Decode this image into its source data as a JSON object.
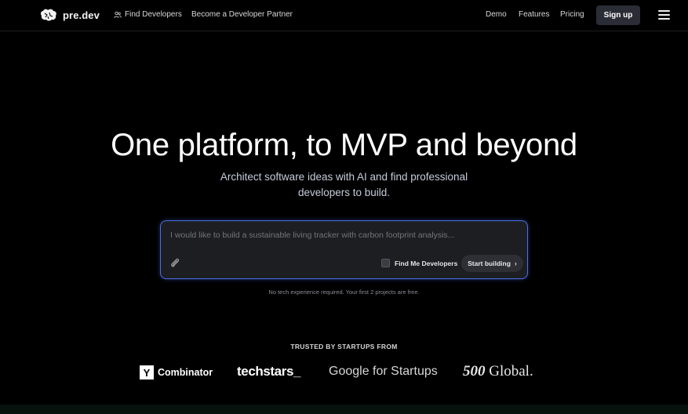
{
  "nav": {
    "brand": "pre.dev",
    "find_developers": "Find Developers",
    "become_partner": "Become a Developer Partner",
    "demo": "Demo",
    "features": "Features",
    "pricing": "Pricing",
    "signup": "Sign up"
  },
  "hero": {
    "title": "One platform, to MVP and beyond",
    "subtitle_line1": "Architect software ideas with AI and find professional",
    "subtitle_line2": "developers to build."
  },
  "prompt": {
    "placeholder": "I would like to build a sustainable living tracker with carbon footprint analysis...",
    "find_me_developers": "Find Me Developers",
    "find_me_developers_checked": false,
    "start_building": "Start building",
    "accent_color": "#4c6fe6"
  },
  "note": "No tech experience required. Your first 2 projects are free.",
  "trusted": {
    "heading": "TRUSTED BY STARTUPS FROM",
    "ycombinator_mark": "Y",
    "ycombinator": "Combinator",
    "techstars": "techstars_",
    "google": "Google",
    "for_startups": "for Startups",
    "global_num": "500",
    "global_word": "Global."
  }
}
